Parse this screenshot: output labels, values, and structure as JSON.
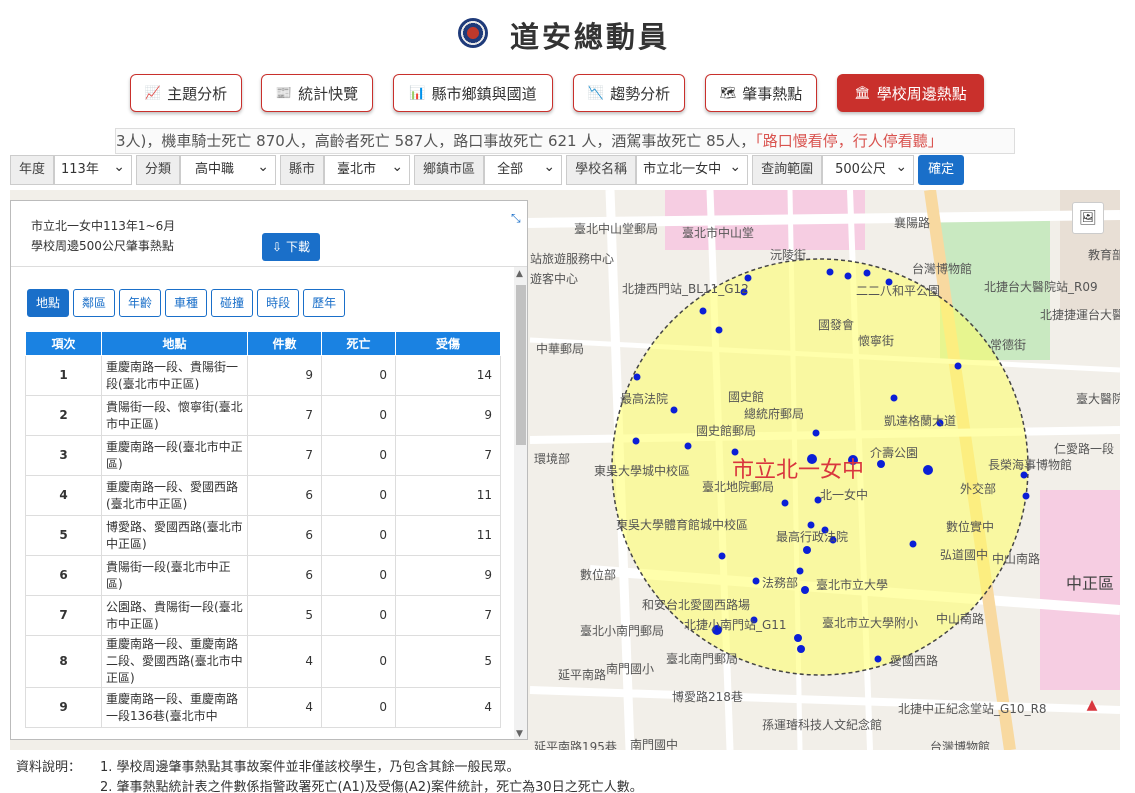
{
  "header": {
    "title": "道安總動員"
  },
  "nav": [
    {
      "label": "主題分析",
      "icon": "line-chart-icon"
    },
    {
      "label": "統計快覽",
      "icon": "newspaper-icon"
    },
    {
      "label": "縣市鄉鎮與國道",
      "icon": "bar-chart-icon"
    },
    {
      "label": "趨勢分析",
      "icon": "area-chart-icon"
    },
    {
      "label": "肇事熱點",
      "icon": "map-icon"
    },
    {
      "label": "學校周邊熱點",
      "icon": "school-icon"
    }
  ],
  "ticker": {
    "text": "3人)，機車騎士死亡 870人，高齡者死亡 587人，路口事故死亡 621 人，酒駕事故死亡 85人，",
    "highlight": "「路口慢看停，行人停看聽」"
  },
  "filters": {
    "year_label": "年度",
    "year_value": "113年",
    "category_label": "分類",
    "category_value": "高中職",
    "city_label": "縣市",
    "city_value": "臺北市",
    "district_label": "鄉鎮市區",
    "district_value": "全部",
    "school_label": "學校名稱",
    "school_value": "市立北一女中",
    "range_label": "查詢範圍",
    "range_value": "500公尺",
    "confirm_label": "確定"
  },
  "panel": {
    "line1": "市立北一女中113年1~6月",
    "line2": "學校周邊500公尺肇事熱點",
    "download_label": "下載",
    "tabs": [
      "地點",
      "鄰區",
      "年齡",
      "車種",
      "碰撞",
      "時段",
      "歷年"
    ],
    "columns": [
      "項次",
      "地點",
      "件數",
      "死亡",
      "受傷"
    ],
    "rows": [
      {
        "idx": "1",
        "loc": "重慶南路一段、貴陽街一段(臺北市中正區)",
        "count": "9",
        "death": "0",
        "injury": "14"
      },
      {
        "idx": "2",
        "loc": "貴陽街一段、懷寧街(臺北市中正區)",
        "count": "7",
        "death": "0",
        "injury": "9"
      },
      {
        "idx": "3",
        "loc": "重慶南路一段(臺北市中正區)",
        "count": "7",
        "death": "0",
        "injury": "7"
      },
      {
        "idx": "4",
        "loc": "重慶南路一段、愛國西路(臺北市中正區)",
        "count": "6",
        "death": "0",
        "injury": "11"
      },
      {
        "idx": "5",
        "loc": "博愛路、愛國西路(臺北市中正區)",
        "count": "6",
        "death": "0",
        "injury": "11"
      },
      {
        "idx": "6",
        "loc": "貴陽街一段(臺北市中正區)",
        "count": "6",
        "death": "0",
        "injury": "9"
      },
      {
        "idx": "7",
        "loc": "公園路、貴陽街一段(臺北市中正區)",
        "count": "5",
        "death": "0",
        "injury": "7"
      },
      {
        "idx": "8",
        "loc": "重慶南路一段、重慶南路二段、愛國西路(臺北市中正區)",
        "count": "4",
        "death": "0",
        "injury": "5"
      },
      {
        "idx": "9",
        "loc": "重慶南路一段、重慶南路一段136巷(臺北市中",
        "count": "4",
        "death": "0",
        "injury": "4"
      }
    ]
  },
  "map": {
    "school_label": "市立北一女中",
    "labels": {
      "l1": "臺北中山堂郵局",
      "l2": "臺北市中山堂",
      "l3": "襄陽路",
      "l4": "沅陵街",
      "l5": "台灣博物館",
      "l6": "北捷西門站_BL11_G12",
      "l7": "二二八和平公園",
      "l8": "北捷台大醫院站_R09",
      "l9": "國發會",
      "l10": "懷寧街",
      "l11": "最高法院",
      "l12": "國史館",
      "l13": "總統府郵局",
      "l14": "凱達格蘭大道",
      "l15": "國史館郵局",
      "l16": "東吳大學城中校區",
      "l17": "北一女中",
      "l18": "介壽公園",
      "l19": "長榮海事博物館",
      "l20": "外交部",
      "l21": "臺北地院郵局",
      "l22": "東吳大學體育館城中校區",
      "l23": "最高行政法院",
      "l24": "數位實中",
      "l25": "弘道國中",
      "l26": "中正區",
      "l27": "數位部",
      "l28": "法務部",
      "l29": "臺北市立大學",
      "l30": "和安台北愛國西路場",
      "l31": "臺北小南門郵局",
      "l32": "北捷小南門站_G11",
      "l33": "臺北市立大學附小",
      "l34": "南門國小",
      "l35": "臺北南門郵局",
      "l36": "博愛路218巷",
      "l37": "延平南路",
      "l38": "孫運璿科技人文紀念館",
      "l39": "北捷中正紀念堂站_G10_R8",
      "l40": "南門國中",
      "l41": "中山南路",
      "l42": "遊客中心",
      "l43": "站旅遊服務中心",
      "l44": "仁愛路一段",
      "l45": "常德街",
      "l46": "臺大醫院",
      "l47": "教育部",
      "l48": "環境部",
      "l49": "愛國西路",
      "l50": "延平南路195巷",
      "l51": "台灣博物館",
      "l52": "中華郵局",
      "l53": "中山南路",
      "l54": "北捷捷運台大醫院站"
    }
  },
  "notes": {
    "label": "資料說明：",
    "n1": "1. 學校周邊肇事熱點其事故案件並非僅該校學生，乃包含其餘一般民眾。",
    "n2": "2. 肇事熱點統計表之件數係指警政署死亡(A1)及受傷(A2)案件統計，死亡為30日之死亡人數。"
  },
  "colors": {
    "accent": "#c9302c",
    "primary": "#1a6fc9",
    "circle": "#ffff66"
  }
}
